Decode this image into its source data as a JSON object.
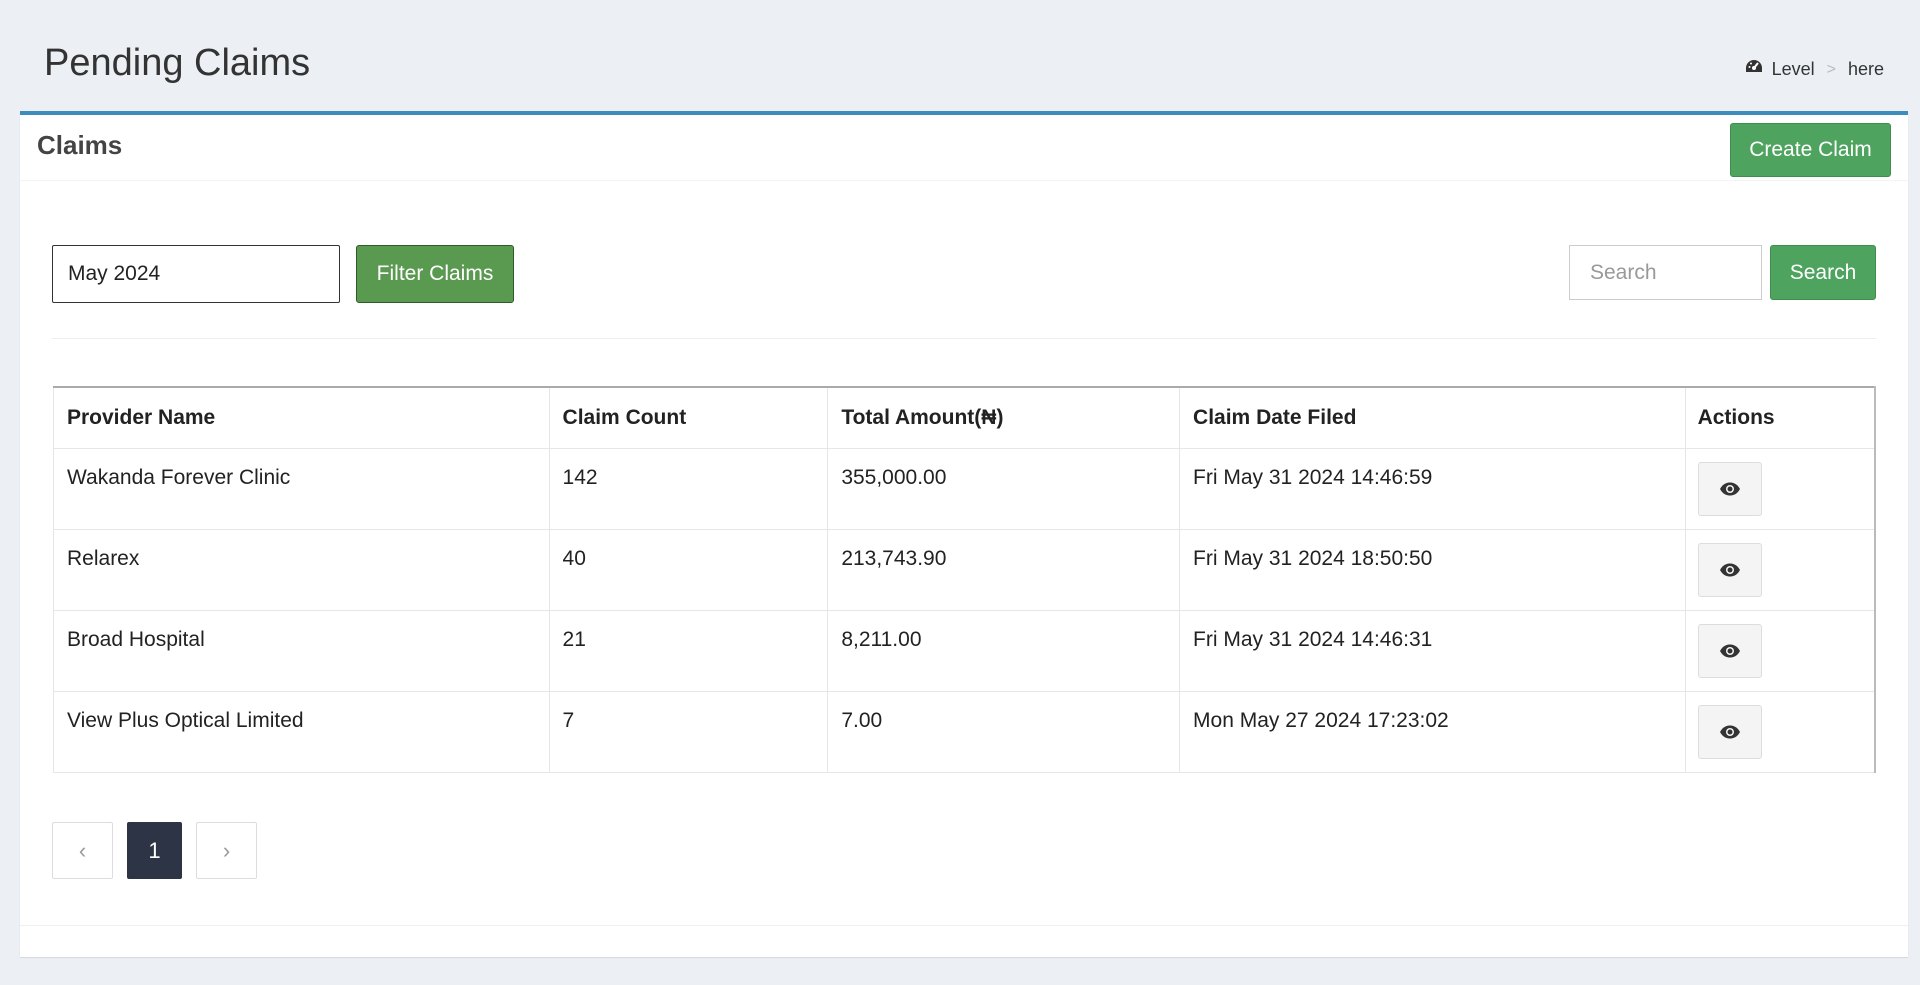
{
  "header": {
    "title": "Pending Claims",
    "breadcrumb": {
      "level": "Level",
      "separator": ">",
      "current": "here"
    }
  },
  "box": {
    "title": "Claims",
    "create_label": "Create Claim"
  },
  "filters": {
    "month_value": "May 2024",
    "filter_label": "Filter Claims",
    "search_placeholder": "Search",
    "search_value": "",
    "search_label": "Search"
  },
  "table": {
    "columns": [
      "Provider Name",
      "Claim Count",
      "Total Amount(₦)",
      "Claim Date Filed",
      "Actions"
    ],
    "rows": [
      {
        "provider": "Wakanda Forever Clinic",
        "count": "142",
        "amount": "355,000.00",
        "date": "Fri May 31 2024 14:46:59"
      },
      {
        "provider": "Relarex",
        "count": "40",
        "amount": "213,743.90",
        "date": "Fri May 31 2024 18:50:50"
      },
      {
        "provider": "Broad Hospital",
        "count": "21",
        "amount": "8,211.00",
        "date": "Fri May 31 2024 14:46:31"
      },
      {
        "provider": "View Plus Optical Limited",
        "count": "7",
        "amount": "7.00",
        "date": "Mon May 27 2024 17:23:02"
      }
    ]
  },
  "pagination": {
    "prev": "‹",
    "current_page": "1",
    "next": "›"
  },
  "icons": {
    "breadcrumb": "dashboard-icon",
    "view": "eye-icon",
    "prev": "chevron-left-icon",
    "next": "chevron-right-icon"
  },
  "colors": {
    "accent": "#3c8dbc",
    "success": "#4ea45e",
    "filter": "#5a9a50",
    "page_active": "#2d3446"
  }
}
